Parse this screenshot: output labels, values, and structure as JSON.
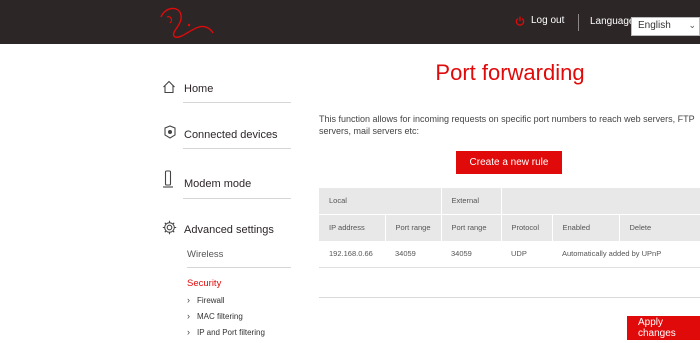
{
  "header": {
    "brand_logo_text": "Virgin media",
    "logout_label": "Log out",
    "language_label": "Language",
    "language_selected": "English",
    "colors": {
      "bar": "#2d2627",
      "accent": "#e10a0a"
    }
  },
  "sidebar": {
    "items": [
      {
        "label": "Home",
        "icon": "home-icon"
      },
      {
        "label": "Connected devices",
        "icon": "devices-icon"
      },
      {
        "label": "Modem mode",
        "icon": "modem-icon"
      },
      {
        "label": "Advanced settings",
        "icon": "gear-icon"
      }
    ],
    "submenu": [
      {
        "label": "Wireless",
        "active": false
      },
      {
        "label": "Security",
        "active": true
      }
    ],
    "security_items": [
      "Firewall",
      "MAC filtering",
      "IP and Port filtering"
    ]
  },
  "main": {
    "title": "Port forwarding",
    "description": "This function allows for incoming requests on specific port numbers to reach web servers, FTP servers, mail servers etc:",
    "create_button": "Create a new rule",
    "apply_button": "Apply changes",
    "table": {
      "group_headers": [
        "Local",
        "External"
      ],
      "columns": [
        "IP address",
        "Port range",
        "Port range",
        "Protocol",
        "Enabled",
        "Delete"
      ],
      "rows": [
        {
          "ip": "192.168.0.66",
          "local_port": "34059",
          "external_port": "34059",
          "protocol": "UDP",
          "enabled": "Automatically added by UPnP"
        }
      ]
    }
  }
}
